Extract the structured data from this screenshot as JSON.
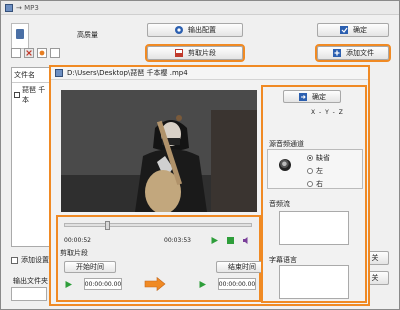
{
  "app": {
    "title": "→ MP3"
  },
  "top": {
    "high_quality_label": "高质量",
    "output_config_label": "输出配置",
    "confirm_label": "确定",
    "cut_clip_label": "剪取片段",
    "add_file_label": "添加文件"
  },
  "file_list": {
    "header": "文件名",
    "rows": [
      {
        "name": "琵琶 千本"
      }
    ]
  },
  "bottom": {
    "add_settings_label": "添加设置名",
    "output_folder_label": "输出文件夹",
    "right_btn": "关",
    "right_btn2": "关"
  },
  "dialog": {
    "title": "D:\\Users\\Desktop\\琵琶 千本樱 .mp4",
    "confirm_label": "确定",
    "xyz_label": "X - Y - Z",
    "audio_channel_label": "源音频通道",
    "radio_options": [
      "缺省",
      "左",
      "右"
    ],
    "selected_radio": "缺省",
    "volume_label": "音频流",
    "subtitle_label": "字幕语言"
  },
  "player": {
    "current_time": "00:00:52",
    "total_time": "00:03:53",
    "progress": 0.22,
    "cut_section_label": "剪取片段",
    "start_time_label": "开始时间",
    "end_time_label": "结束时间",
    "start_value": "00:00:00.00",
    "end_value": "00:00:00.00"
  },
  "colors": {
    "highlight": "#f08a24",
    "accent_blue": "#2b5fb0"
  }
}
